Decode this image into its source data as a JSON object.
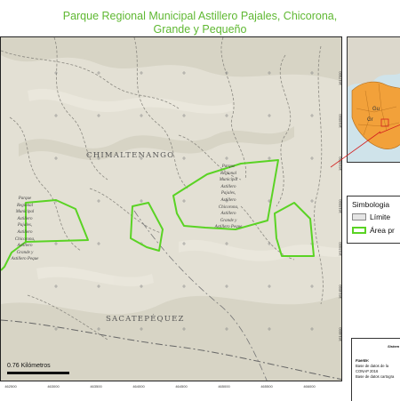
{
  "title": {
    "line1": "Parque Regional Municipal Astillero Pajales, Chicorona,",
    "line2": "Grande y Pequeño"
  },
  "grid": {
    "x_ticks": [
      "462500",
      "463000",
      "463500",
      "464000",
      "464500",
      "465000",
      "465500",
      "466000"
    ],
    "y_ticks": [
      "1617000",
      "1616500",
      "1616000",
      "1615500",
      "1615000",
      "1614500",
      "1614000"
    ]
  },
  "map": {
    "regions": [
      "CHIMALTENANGO",
      "SACATEPÉQUEZ"
    ],
    "park_labels": [
      {
        "lines": [
          "Parque",
          "Regional",
          "Municipal",
          "Astillero",
          "Pajales,",
          "Astillero",
          "Chicorona,",
          "Astillero",
          "Grande y",
          "Astillero Peque"
        ]
      },
      {
        "lines": [
          "Parque",
          "Regional",
          "Municipal",
          "Astillero",
          "Pajales,",
          "Astillero",
          "Chicorona,",
          "Astillero",
          "Grande y",
          "Astillero Peque"
        ]
      }
    ],
    "colors": {
      "terrain": "#e3e0d4",
      "park_boundary": "#5ad324",
      "roads": "#777777"
    }
  },
  "scale_bar": {
    "label": "0.76 Kilómetros"
  },
  "inset": {
    "labels": [
      "Gu",
      "Gr"
    ],
    "colors": {
      "sea": "#cfe3ea",
      "land": "#dcd8cc",
      "country": "#f2a13a"
    }
  },
  "legend": {
    "title": "Simbologia",
    "items": [
      {
        "label": "Límite",
        "icon": "limit-swatch"
      },
      {
        "label": "Área pr",
        "icon": "area-swatch"
      }
    ]
  },
  "info_box": {
    "system": "Sistem",
    "source_lines": [
      "Fuente:",
      "Base de datos de la",
      "CONAP 2016",
      "Base de datos cartogra"
    ]
  }
}
